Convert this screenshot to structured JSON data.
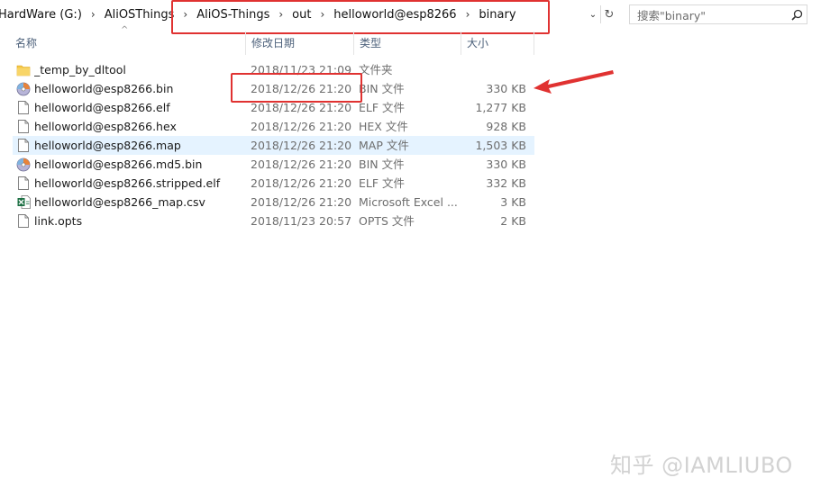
{
  "address": {
    "crumbs": [
      "HardWare (G:)",
      "AliOSThings",
      "AliOS-Things",
      "out",
      "helloworld@esp8266",
      "binary"
    ],
    "separator": "›",
    "dropdown_glyph": "⌄",
    "refresh_glyph": "↻"
  },
  "search": {
    "placeholder": "搜索\"binary\"",
    "icon": "search-icon"
  },
  "columns": {
    "name": "名称",
    "date": "修改日期",
    "type": "类型",
    "size": "大小",
    "sort_glyph": "^"
  },
  "files": [
    {
      "name": "_temp_by_dltool",
      "date": "2018/11/23 21:09",
      "type": "文件夹",
      "size": "",
      "icon": "folder-icon"
    },
    {
      "name": "helloworld@esp8266.bin",
      "date": "2018/12/26 21:20",
      "type": "BIN 文件",
      "size": "330 KB",
      "icon": "disc-file-icon"
    },
    {
      "name": "helloworld@esp8266.elf",
      "date": "2018/12/26 21:20",
      "type": "ELF 文件",
      "size": "1,277 KB",
      "icon": "file-icon"
    },
    {
      "name": "helloworld@esp8266.hex",
      "date": "2018/12/26 21:20",
      "type": "HEX 文件",
      "size": "928 KB",
      "icon": "file-icon"
    },
    {
      "name": "helloworld@esp8266.map",
      "date": "2018/12/26 21:20",
      "type": "MAP 文件",
      "size": "1,503 KB",
      "icon": "file-icon",
      "selected": true
    },
    {
      "name": "helloworld@esp8266.md5.bin",
      "date": "2018/12/26 21:20",
      "type": "BIN 文件",
      "size": "330 KB",
      "icon": "disc-file-icon"
    },
    {
      "name": "helloworld@esp8266.stripped.elf",
      "date": "2018/12/26 21:20",
      "type": "ELF 文件",
      "size": "332 KB",
      "icon": "file-icon"
    },
    {
      "name": "helloworld@esp8266_map.csv",
      "date": "2018/12/26 21:20",
      "type": "Microsoft Excel ...",
      "size": "3 KB",
      "icon": "excel-file-icon"
    },
    {
      "name": "link.opts",
      "date": "2018/11/23 20:57",
      "type": "OPTS 文件",
      "size": "2 KB",
      "icon": "file-icon"
    }
  ],
  "watermark": "知乎 @IAMLIUBO",
  "colors": {
    "annotation_red": "#e03231",
    "selected_row": "#e5f3ff",
    "header_text": "#4c607a",
    "folder_yellow": "#f5c644",
    "excel_green": "#1d7044"
  }
}
